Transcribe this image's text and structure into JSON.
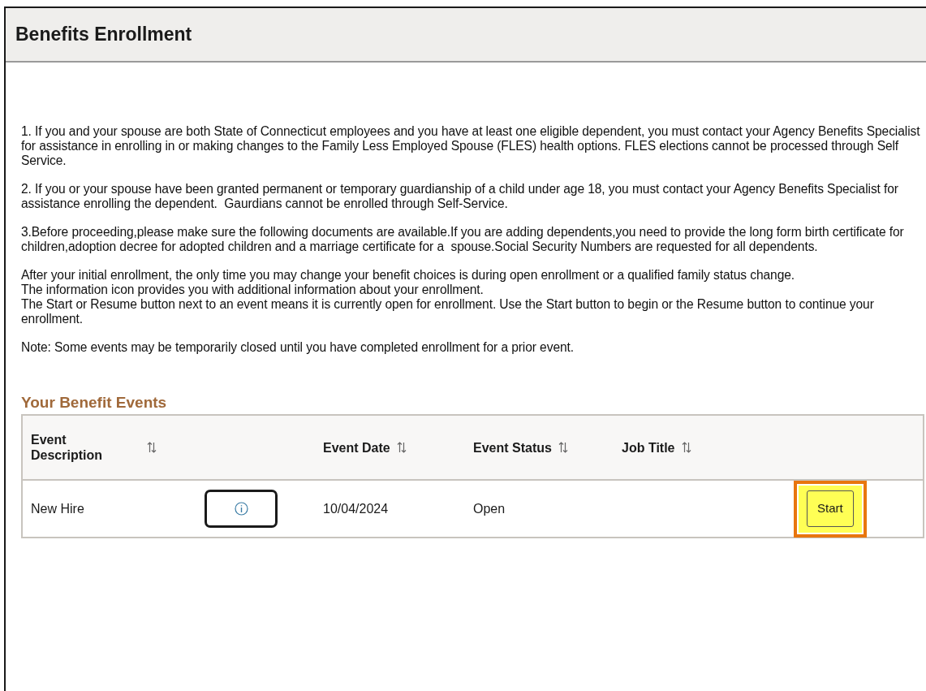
{
  "page": {
    "title": "Benefits Enrollment"
  },
  "instructions": [
    [
      "1. If you and your spouse are both State of Connecticut employees and you have at least one eligible dependent, you must contact your Agency Benefits Specialist for assistance in enrolling in or making changes to the Family Less Employed Spouse (FLES) health options. FLES elections cannot be processed through Self Service."
    ],
    [
      "2. If you or your spouse have been granted permanent or temporary guardianship of a child under age 18, you must contact your Agency Benefits Specialist for assistance enrolling the dependent.  Gaurdians cannot be enrolled through Self-Service."
    ],
    [
      "3.Before proceeding,please make sure the following documents are available.If you are adding dependents,you need to provide the long form birth certificate for children,adoption decree for adopted children and a marriage certificate for a  spouse.Social Security Numbers are requested for all dependents."
    ],
    [
      "After your initial enrollment, the only time you may change your benefit choices is during open enrollment or a qualified family status change.",
      "The information icon provides you with additional information about your enrollment.",
      "The Start or Resume button next to an event means it is currently open for enrollment. Use the Start button to begin or the Resume button to continue your enrollment."
    ],
    [
      "Note: Some events may be temporarily closed until you have completed enrollment for a prior event."
    ]
  ],
  "events": {
    "heading": "Your Benefit Events",
    "columns": [
      "Event Description",
      "Event Date",
      "Event Status",
      "Job Title"
    ],
    "rows": [
      {
        "description": "New Hire",
        "date": "10/04/2024",
        "status": "Open",
        "action": "Start",
        "highlighted": true
      }
    ]
  }
}
